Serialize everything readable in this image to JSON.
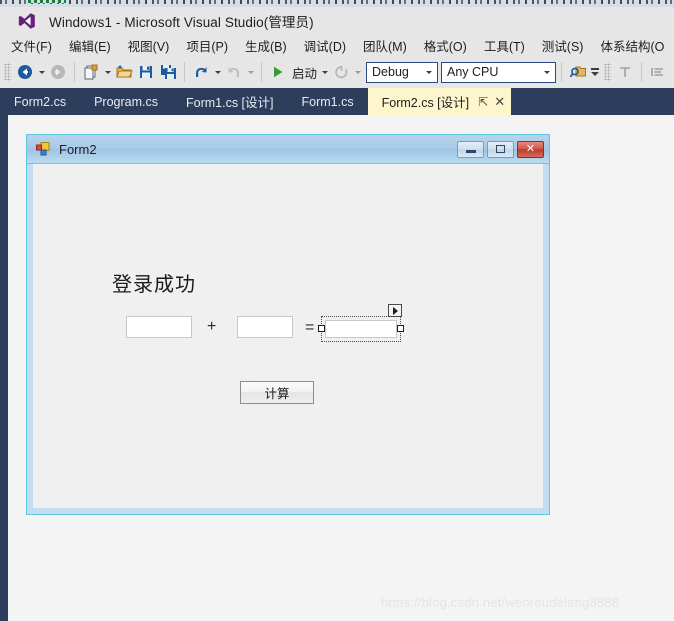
{
  "window": {
    "title": "Windows1 - Microsoft Visual Studio(管理员)",
    "logo_icon": "visual-studio-logo-icon"
  },
  "menubar": {
    "items": [
      {
        "label": "文件(F)"
      },
      {
        "label": "编辑(E)"
      },
      {
        "label": "视图(V)"
      },
      {
        "label": "项目(P)"
      },
      {
        "label": "生成(B)"
      },
      {
        "label": "调试(D)"
      },
      {
        "label": "团队(M)"
      },
      {
        "label": "格式(O)"
      },
      {
        "label": "工具(T)"
      },
      {
        "label": "测试(S)"
      },
      {
        "label": "体系结构(O"
      }
    ]
  },
  "toolbar": {
    "navigate_back_icon": "navigate-back-icon",
    "navigate_forward_icon": "navigate-forward-icon",
    "new_item_icon": "new-item-icon",
    "open_file_icon": "open-folder-icon",
    "save_icon": "save-icon",
    "save_all_icon": "save-all-icon",
    "undo_icon": "undo-icon",
    "redo_icon": "redo-icon",
    "start_icon": "start-play-icon",
    "start_label": "启动",
    "restart_icon": "restart-icon",
    "configuration": {
      "value": "Debug"
    },
    "platform": {
      "value": "Any CPU"
    },
    "find_icon": "find-in-files-icon",
    "overflow_icon": "toolbar-overflow-icon",
    "align_icon": "align-to-grid-icon",
    "order_icon": "order-list-icon"
  },
  "tabs": {
    "items": [
      {
        "label": "Form2.cs",
        "active": false
      },
      {
        "label": "Program.cs",
        "active": false
      },
      {
        "label": "Form1.cs [设计]",
        "active": false
      },
      {
        "label": "Form1.cs",
        "active": false
      },
      {
        "label": "Form2.cs [设计]",
        "active": true
      }
    ],
    "pin_glyph": "⇱",
    "close_glyph": "✕"
  },
  "designer": {
    "form": {
      "icon": "windows-form-icon",
      "title": "Form2",
      "controls": {
        "minimize_glyph": "minimize-icon",
        "maximize_glyph": "maximize-icon",
        "close_glyph": "✕"
      },
      "label_success": "登录成功",
      "textbox_a": "",
      "textbox_b": "",
      "textbox_c": "",
      "operator_plus": "+",
      "operator_equals": "=",
      "button_calc": "计算",
      "smart_tag_icon": "smart-tag-arrow-icon",
      "selection_handle_icon": "selection-handle-icon"
    }
  },
  "watermark": {
    "text": "https://blog.csdn.net/wenroudelang8888"
  },
  "colors": {
    "tabstrip_bg": "#2d3d5c",
    "active_tab_bg": "#fdf6cd",
    "chrome_bg": "#e6e6e6",
    "designer_bg": "#f4f4f4",
    "form_title_blue": "#a8cbe8",
    "form_accent": "#5ec8dd",
    "close_red": "#bb3e30"
  }
}
